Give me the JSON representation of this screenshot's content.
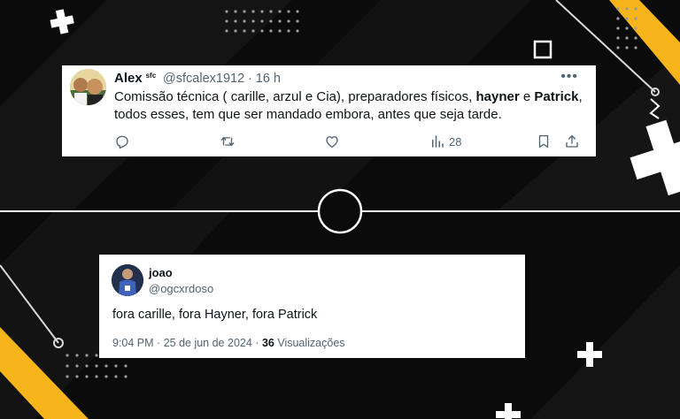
{
  "colors": {
    "background": "#0b0b0b",
    "accent_yellow": "#f7b51b",
    "card_bg": "#ffffff",
    "text_primary": "#0f1419",
    "text_muted": "#536471"
  },
  "tweet1": {
    "author_name": "Alex",
    "author_badge": "sfc",
    "handle": "@sfcalex1912",
    "separator": "·",
    "time": "16 h",
    "more_label": "•••",
    "text_segments": [
      "Comissão técnica ( carille, arzul e Cia), preparadores físicos, ",
      "hayner",
      " e ",
      "Patrick",
      ", todos esses, tem que ser mandado embora, antes que seja tarde."
    ],
    "views_count": "28",
    "icons": [
      "reply-icon",
      "retweet-icon",
      "like-icon",
      "views-icon",
      "bookmark-icon",
      "share-icon"
    ]
  },
  "tweet2": {
    "author_name": "joao",
    "handle": "@ogcxrdoso",
    "text": "fora carille, fora Hayner, fora Patrick",
    "time": "9:04 PM",
    "date": "25 de jun de 2024",
    "separator": "·",
    "views_count": "36",
    "views_label": "Visualizações"
  },
  "decorations": [
    "plus-icon",
    "square-outline-icon",
    "circle-outline-icon",
    "dot-grid-icon"
  ]
}
